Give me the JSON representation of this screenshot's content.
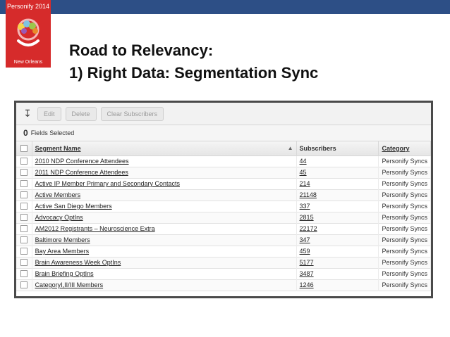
{
  "logo": {
    "top_text": "Personify 2014",
    "bottom_text": "New Orleans"
  },
  "title": {
    "line1": "Road to Relevancy:",
    "line2": "1) Right Data: Segmentation Sync"
  },
  "toolbar": {
    "export_icon": "down-arrow-icon",
    "edit_label": "Edit",
    "delete_label": "Delete",
    "clear_label": "Clear Subscribers"
  },
  "selection": {
    "count": "0",
    "label": "Fields Selected"
  },
  "table": {
    "headers": {
      "segment_name": "Segment Name",
      "subscribers": "Subscribers",
      "category": "Category"
    },
    "rows": [
      {
        "name": "2010 NDP Conference Attendees",
        "subscribers": "44",
        "category": "Personify Syncs"
      },
      {
        "name": "2011 NDP Conference Attendees",
        "subscribers": "45",
        "category": "Personify Syncs"
      },
      {
        "name": "Active IP Member Primary and Secondary Contacts",
        "subscribers": "214",
        "category": "Personify Syncs"
      },
      {
        "name": "Active Members",
        "subscribers": "21148",
        "category": "Personify Syncs"
      },
      {
        "name": "Active San Diego Members",
        "subscribers": "337",
        "category": "Personify Syncs"
      },
      {
        "name": "Advocacy OptIns",
        "subscribers": "2815",
        "category": "Personify Syncs"
      },
      {
        "name": "AM2012 Registrants – Neuroscience Extra",
        "subscribers": "22172",
        "category": "Personify Syncs"
      },
      {
        "name": "Baltimore Members",
        "subscribers": "347",
        "category": "Personify Syncs"
      },
      {
        "name": "Bay Area Members",
        "subscribers": "459",
        "category": "Personify Syncs"
      },
      {
        "name": "Brain Awareness Week OptIns",
        "subscribers": "5177",
        "category": "Personify Syncs"
      },
      {
        "name": "Brain Briefing OptIns",
        "subscribers": "3487",
        "category": "Personify Syncs"
      },
      {
        "name": "CategoryI,II/III Members",
        "subscribers": "1246",
        "category": "Personify Syncs"
      }
    ]
  },
  "colors": {
    "band": "#2d4f86",
    "logo_bg": "#d62b2b"
  }
}
